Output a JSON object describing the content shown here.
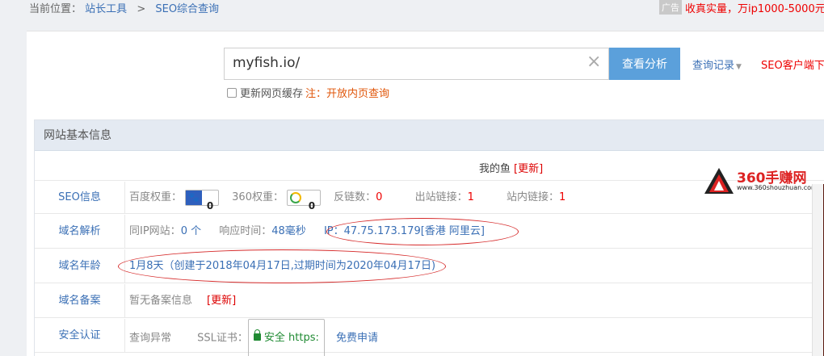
{
  "breadcrumb": {
    "prefix": "当前位置：",
    "items": [
      "站长工具",
      "SEO综合查询"
    ],
    "separator": ">"
  },
  "ad": {
    "tag": "广告",
    "text": "收真实量，万ip1000-5000元"
  },
  "search": {
    "value": "myfish.io/",
    "clear_glyph": "×",
    "button": "查看分析",
    "history": "查询记录",
    "history_caret": "▼",
    "client_link": "SEO客户端下"
  },
  "cache": {
    "label": "更新网页缓存",
    "note": "注：开放内页查询"
  },
  "section": {
    "title": "网站基本信息"
  },
  "site": {
    "name": "我的鱼",
    "refresh": "[更新]"
  },
  "seo": {
    "label": "SEO信息",
    "baidu_label": "百度权重：",
    "baidu_value": "0",
    "s360_label": "360权重：",
    "s360_value": "0",
    "backlinks_label": "反链数：",
    "backlinks_value": "0",
    "outlinks_label": "出站链接：",
    "outlinks_value": "1",
    "inlinks_label": "站内链接：",
    "inlinks_value": "1"
  },
  "dns": {
    "label": "域名解析",
    "same_ip_label": "同IP网站：",
    "same_ip_value": "0 个",
    "response_label": "响应时间：",
    "response_value": "48毫秒",
    "ip_text": "IP：47.75.173.179[香港 阿里云]"
  },
  "age": {
    "label": "域名年龄",
    "value": "1月8天（创建于2018年04月17日,过期时间为2020年04月17日)"
  },
  "icp": {
    "label": "域名备案",
    "value": "暂无备案信息",
    "refresh": "[更新]"
  },
  "security": {
    "label": "安全认证",
    "status": "查询异常",
    "ssl_label": "SSL证书：",
    "ssl_badge": "安全 https:",
    "apply_link": "免费申请"
  },
  "watermark": {
    "title": "360手赚网",
    "url": "www.360shouzhuan.com"
  },
  "colors": {
    "accent_blue": "#5ba0db",
    "link_blue": "#3a6fb5",
    "alert_red": "#e00000",
    "annotation_red": "#d62b2b",
    "header_bg": "#e4eaf2"
  }
}
